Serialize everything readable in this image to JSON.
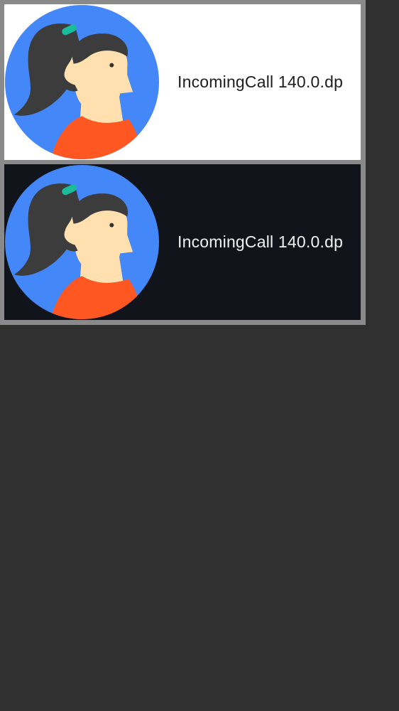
{
  "previews": [
    {
      "theme": "light",
      "label": "IncomingCall 140.0.dp",
      "background": "#ffffff",
      "text_color": "#1d1d1d"
    },
    {
      "theme": "dark",
      "label": "IncomingCall 140.0.dp",
      "background": "#11141a",
      "text_color": "#f2f2f2"
    }
  ],
  "avatar": {
    "icon": "avatar-woman-ponytail-icon",
    "colors": {
      "circle": "#4487f8",
      "hair": "#3c3c3c",
      "skin": "#ffe0ae",
      "shirt": "#ff5722",
      "clip": "#1abc9c",
      "eye": "#333333"
    }
  },
  "colors": {
    "app_background": "#303030",
    "frame_border": "#8a8a8a"
  }
}
